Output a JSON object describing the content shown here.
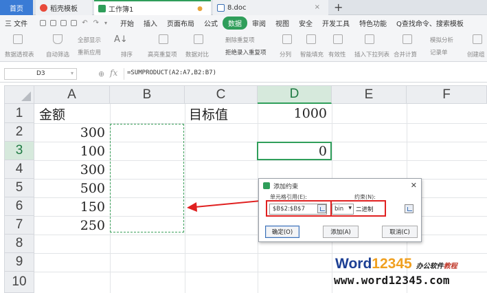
{
  "tabs": {
    "home": "首页",
    "templates": "稻壳模板",
    "doc1": "工作簿1",
    "doc2": "8.doc"
  },
  "menu": {
    "file": "三 文件",
    "items": [
      "开始",
      "插入",
      "页面布局",
      "公式",
      "数据",
      "审阅",
      "视图",
      "安全",
      "开发工具",
      "特色功能"
    ],
    "active": "数据",
    "search": "Q查找命令、搜索模板"
  },
  "ribbon": {
    "pivot": "数据透视表",
    "autofilter": "自动筛选",
    "show_all": "全部显示",
    "reapply": "重新应用",
    "sort": "排序",
    "highlight_dup": "高亮重复项",
    "data_compare": "数据对比",
    "remove_dup": "删除重复项",
    "reject_dup": "拒绝录入重复项",
    "split": "分列",
    "fill": "智能填充",
    "validity": "有效性",
    "dropdown": "插入下拉列表",
    "consolidate": "合并计算",
    "simulate": "模拟分析",
    "record": "记录单",
    "create": "创建组"
  },
  "formula_bar": {
    "cell_ref": "D3",
    "fx": "fx",
    "formula": "=SUMPRODUCT(A2:A7,B2:B7)"
  },
  "columns": [
    "A",
    "B",
    "C",
    "D",
    "E",
    "F"
  ],
  "rows": [
    "1",
    "2",
    "3",
    "4",
    "5",
    "6",
    "7",
    "8",
    "9",
    "10"
  ],
  "selected_column": "D",
  "selected_row": "3",
  "cells": {
    "A1": "金额",
    "A2": "300",
    "A3": "100",
    "A4": "300",
    "A5": "500",
    "A6": "150",
    "A7": "250",
    "C1": "目标值",
    "D1": "1000",
    "D3": "0"
  },
  "dialog": {
    "title": "添加约束",
    "cell_ref_label": "单元格引用(E):",
    "cell_ref_value": "$B$2:$B$7",
    "operator": "bin",
    "constraint_label": "约束(N):",
    "constraint_value": "二进制",
    "ok": "确定(O)",
    "add": "添加(A)",
    "cancel": "取消(C)"
  },
  "watermark": {
    "brand_w": "W",
    "brand_ord": "ord",
    "brand_num": "12345",
    "tagline": "办公软件",
    "tagline_tail": "教程",
    "url": "www.word12345.com"
  },
  "colors": {
    "accent_green": "#2f9e5a",
    "highlight_red": "#e02020",
    "arrow_red": "#e02020"
  }
}
